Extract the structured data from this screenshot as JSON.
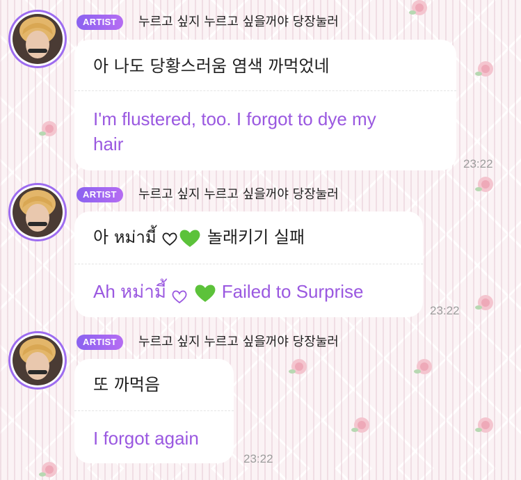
{
  "messages": [
    {
      "badge": "ARTIST",
      "name": "누르고 싶지 누르고 싶을꺼야 당장눌러",
      "original": "아 나도 당황스러움 염색 까먹었네",
      "translation_line1": "I'm flustered, too. I forgot to dye my",
      "translation_line2": "hair",
      "time": "23:22"
    },
    {
      "badge": "ARTIST",
      "name": "누르고 싶지 누르고 싶을꺼야 당장눌러",
      "original_a": "아 หม่ามี้",
      "original_b": "놀래키기 실패",
      "translation_a": "Ah หม่ามี้",
      "translation_b": "Failed to Surprise",
      "time": "23:22"
    },
    {
      "badge": "ARTIST",
      "name": "누르고 싶지 누르고 싶을꺼야 당장눌러",
      "original": "또 까먹음",
      "translation": "I forgot again",
      "time": "23:22"
    }
  ],
  "icons": {
    "avatar": "artist-avatar",
    "green_heart": "green-heart-icon",
    "outline_heart": "outline-heart-icon",
    "background_rose": "rose-icon"
  },
  "colors": {
    "badge": "#9d6cf0",
    "translation": "#9a58e0",
    "bubble": "#ffffff",
    "time": "#9c9c9c"
  }
}
